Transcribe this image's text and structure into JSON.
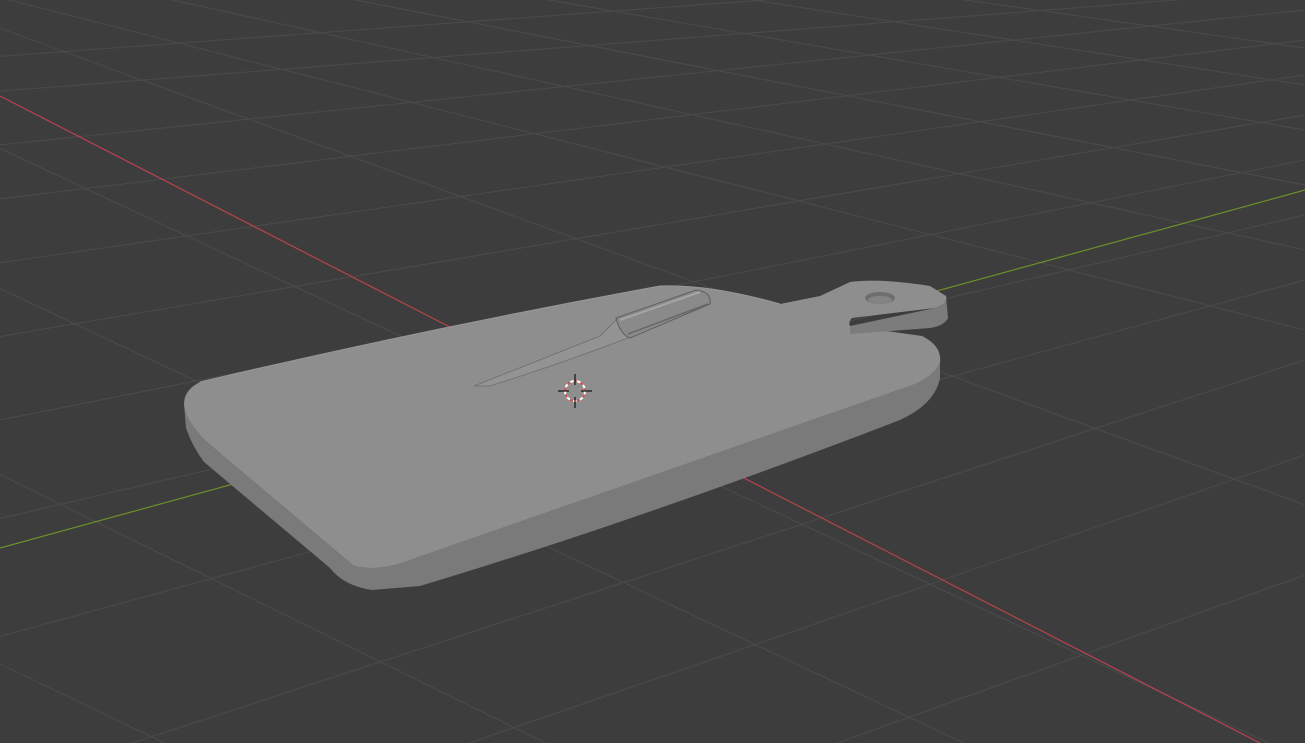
{
  "viewport": {
    "editor": "3D Viewport",
    "shading": "solid"
  },
  "colors": {
    "background": "#3d3d3d",
    "grid_line": "#4a4a4a",
    "x_axis": "#b8434f",
    "y_axis": "#6c8f2b",
    "model_top": "#8d8d8d",
    "model_side": "#7d7d7d",
    "cursor_red": "#e05050"
  },
  "scene": {
    "objects": [
      {
        "name": "cutting-board",
        "type": "mesh"
      },
      {
        "name": "knife",
        "type": "mesh"
      }
    ],
    "cursor": {
      "type": "3d-cursor"
    }
  }
}
